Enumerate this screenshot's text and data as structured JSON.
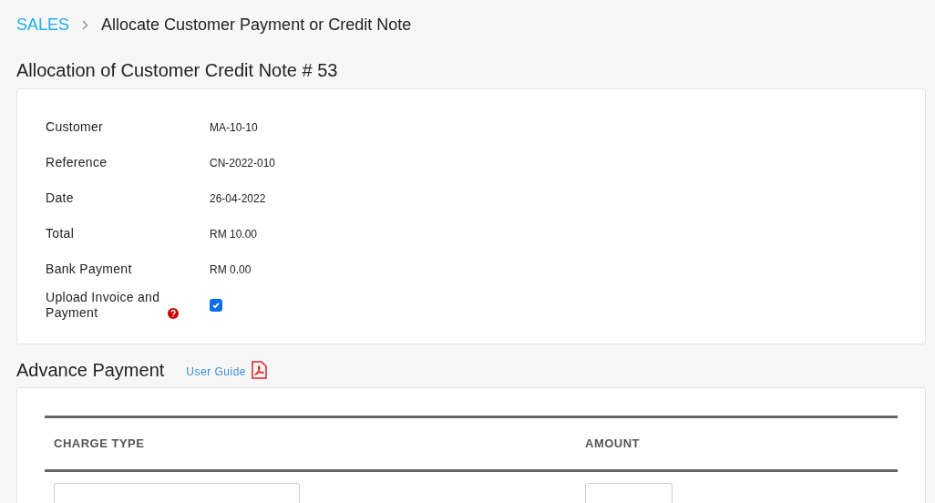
{
  "breadcrumb": {
    "section": "SALES",
    "page": "Allocate Customer Payment or Credit Note"
  },
  "allocation": {
    "title": "Allocation of Customer Credit Note # 53",
    "rows": [
      {
        "kind": "text",
        "label": "Customer",
        "value": "MA-10-10"
      },
      {
        "kind": "text",
        "label": "Reference",
        "value": "CN-2022-010"
      },
      {
        "kind": "text",
        "label": "Date",
        "value": "26-04-2022"
      },
      {
        "kind": "text",
        "label": "Total",
        "value": "RM 10.00"
      },
      {
        "kind": "text",
        "label": "Bank Payment",
        "value": "RM 0.00"
      },
      {
        "kind": "checkbox",
        "label": "Upload Invoice and Payment",
        "checked": true,
        "help": true
      }
    ]
  },
  "advance_payment": {
    "title": "Advance Payment",
    "guide_link": "User Guide",
    "table": {
      "columns": [
        "CHARGE TYPE",
        "AMOUNT"
      ]
    }
  }
}
